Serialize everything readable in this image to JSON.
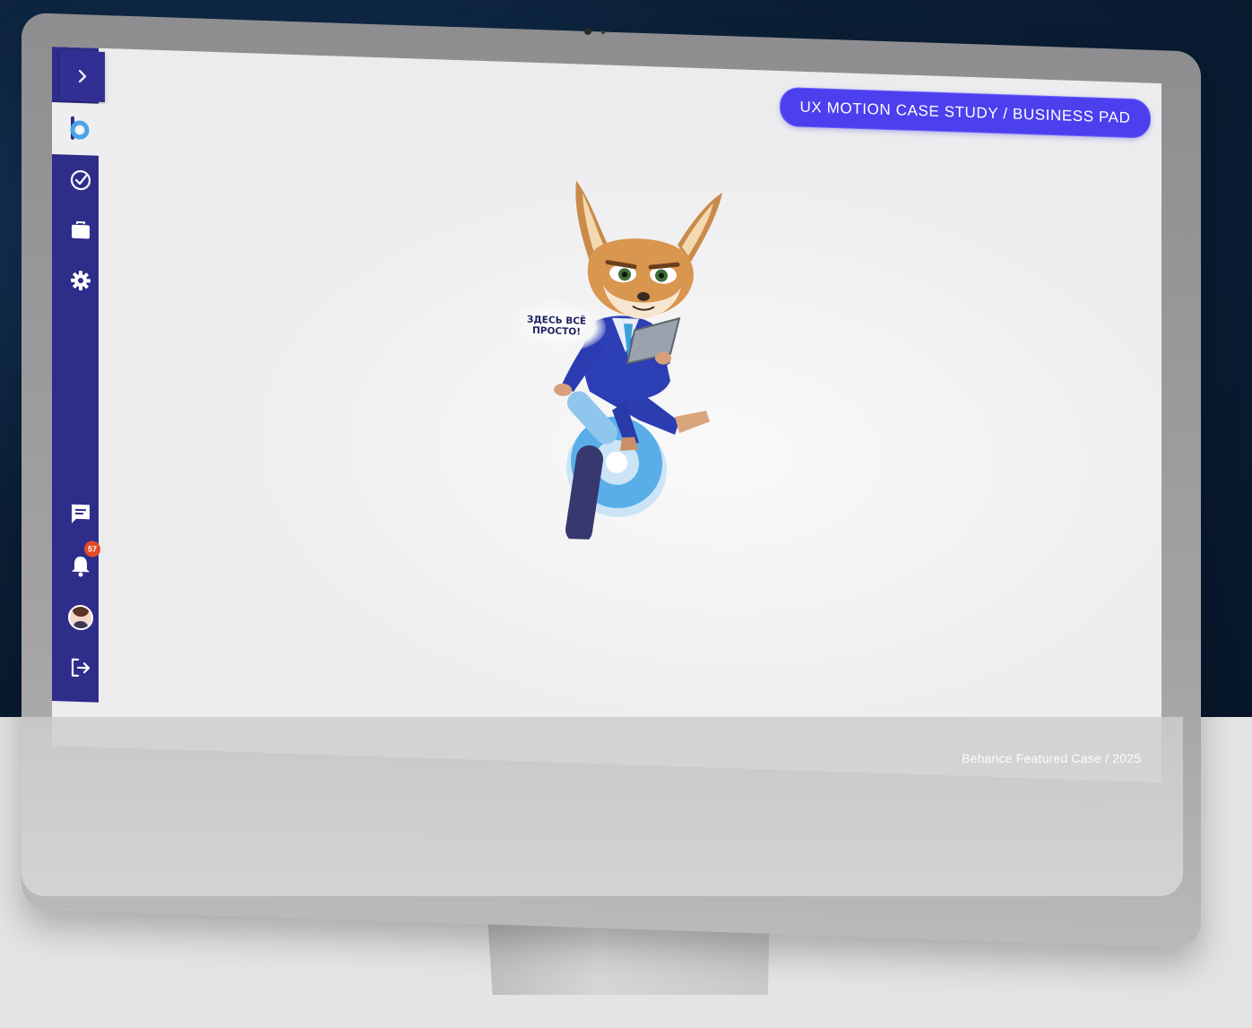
{
  "header": {
    "badge_text": "UX MOTION CASE STUDY / BUSINESS PAD"
  },
  "sidebar": {
    "items": [
      {
        "icon": "chevron-right-icon"
      },
      {
        "icon": "business-pad-logo-icon"
      },
      {
        "icon": "check-circle-icon"
      },
      {
        "icon": "briefcase-icon"
      },
      {
        "icon": "gear-icon"
      },
      {
        "icon": "chat-icon"
      },
      {
        "icon": "bell-icon"
      },
      {
        "icon": "avatar"
      },
      {
        "icon": "logout-icon"
      }
    ],
    "notification_count": "57"
  },
  "mascot": {
    "speech_line1": "ЗДЕСЬ ВСЁ",
    "speech_line2": "ПРОСТО!"
  },
  "caption": "Behance Featured Case / 2025",
  "colors": {
    "sidebar": "#2e2d8a",
    "accent_pill": "#4b3fee",
    "screen_bg": "#ececee",
    "badge": "#e24a2a",
    "logo_blue": "#4aa3e8"
  }
}
